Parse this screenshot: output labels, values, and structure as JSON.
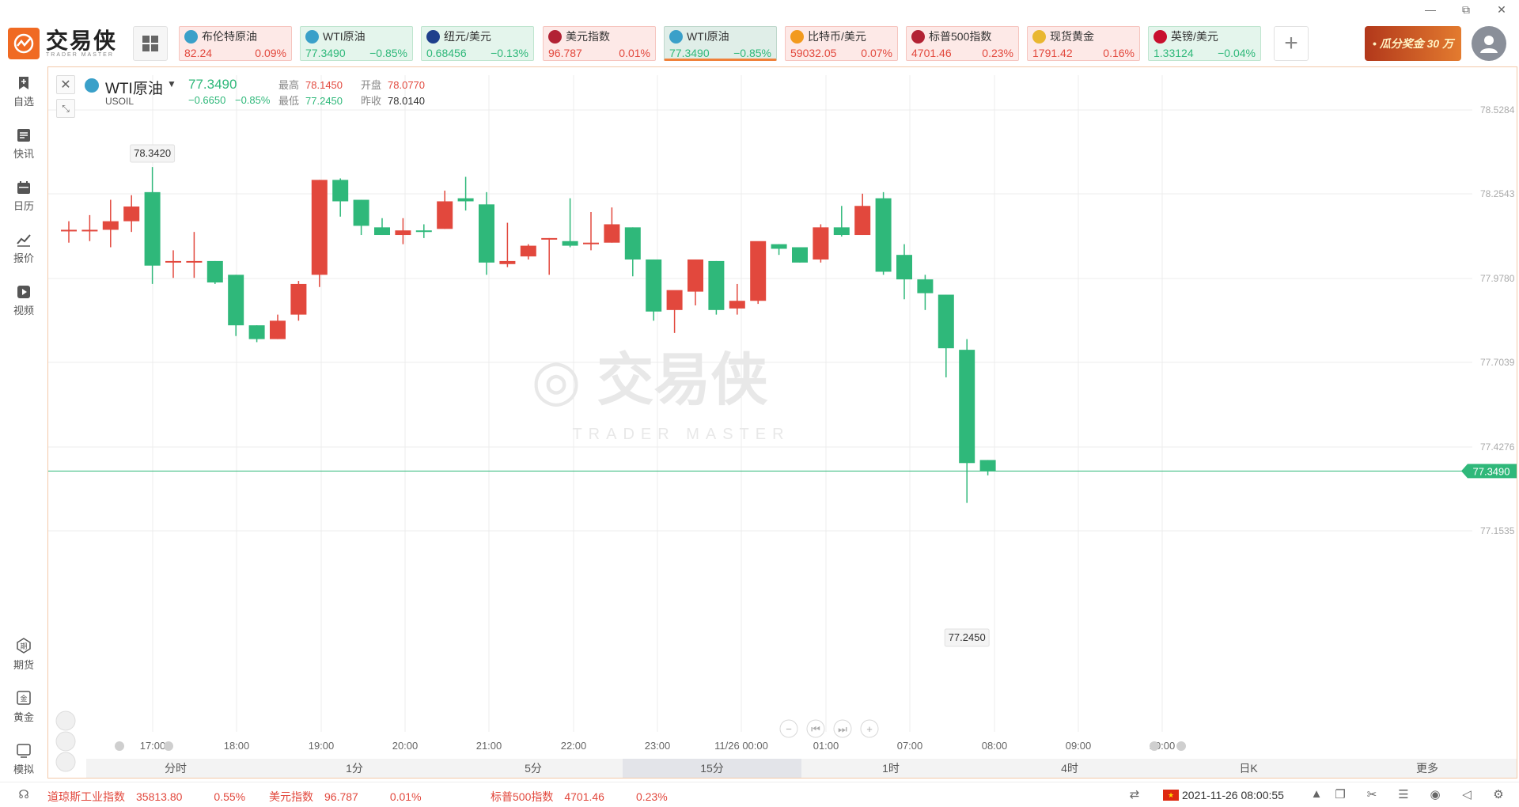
{
  "window": {
    "minimize": "—",
    "restore": "⧉",
    "close": "✕"
  },
  "logo": {
    "cn": "交易侠",
    "en": "TRADER MASTER"
  },
  "tickers": [
    {
      "name": "布伦特原油",
      "price": "82.24",
      "change": "0.09%",
      "dir": "up",
      "flag": "#3aa0c9"
    },
    {
      "name": "WTI原油",
      "price": "77.3490",
      "change": "−0.85%",
      "dir": "dn",
      "flag": "#3aa0c9"
    },
    {
      "name": "纽元/美元",
      "price": "0.68456",
      "change": "−0.13%",
      "dir": "dn",
      "flag": "#1f3f8c"
    },
    {
      "name": "美元指数",
      "price": "96.787",
      "change": "0.01%",
      "dir": "up",
      "flag": "#b22234"
    },
    {
      "name": "WTI原油",
      "price": "77.3490",
      "change": "−0.85%",
      "dir": "sel",
      "flag": "#3aa0c9"
    },
    {
      "name": "比特币/美元",
      "price": "59032.05",
      "change": "0.07%",
      "dir": "up",
      "flag": "#f29a1e"
    },
    {
      "name": "标普500指数",
      "price": "4701.46",
      "change": "0.23%",
      "dir": "up",
      "flag": "#b22234"
    },
    {
      "name": "现货黄金",
      "price": "1791.42",
      "change": "0.16%",
      "dir": "up",
      "flag": "#e9b730"
    },
    {
      "name": "英镑/美元",
      "price": "1.33124",
      "change": "−0.04%",
      "dir": "dn",
      "flag": "#c8102e"
    }
  ],
  "add_label": "+",
  "promo": "• 瓜分奖金 30 万",
  "sidebar": {
    "top": [
      {
        "label": "自选",
        "icon": "bookmark-add-icon"
      },
      {
        "label": "快讯",
        "icon": "news-icon"
      },
      {
        "label": "日历",
        "icon": "calendar-icon"
      },
      {
        "label": "报价",
        "icon": "chart-line-icon"
      },
      {
        "label": "视频",
        "icon": "video-icon"
      }
    ],
    "bottom": [
      {
        "label": "期货",
        "icon": "futures-icon"
      },
      {
        "label": "黄金",
        "icon": "gold-icon"
      },
      {
        "label": "模拟",
        "icon": "simulate-icon"
      }
    ]
  },
  "symbol": {
    "name": "WTI原油",
    "code": "USOIL",
    "price": "77.3490",
    "change": "−0.6650",
    "change_pct": "−0.85%",
    "stats": [
      {
        "key": "最高",
        "value": "78.1450",
        "tone": "up"
      },
      {
        "key": "开盘",
        "value": "78.0770",
        "tone": "up"
      },
      {
        "key": "最低",
        "value": "77.2450",
        "tone": "dn"
      },
      {
        "key": "昨收",
        "value": "78.0140",
        "tone": "n"
      }
    ]
  },
  "chart_data": {
    "type": "candlestick",
    "y_ticks": [
      "78.5284",
      "78.2543",
      "77.9780",
      "77.7039",
      "77.4276",
      "77.1535"
    ],
    "y_tick_values": [
      78.5284,
      78.2543,
      77.978,
      77.7039,
      77.4276,
      77.1535
    ],
    "x_ticks": [
      "17:00",
      "18:00",
      "19:00",
      "20:00",
      "21:00",
      "22:00",
      "23:00",
      "11/26 00:00",
      "01:00",
      "07:00",
      "08:00",
      "09:00",
      "10:00"
    ],
    "current_price": "77.3490",
    "current_price_value": 77.349,
    "high_label": "78.3420",
    "low_label": "77.2450",
    "candles": [
      {
        "o": 78.137,
        "h": 78.165,
        "l": 78.095,
        "c": 78.137
      },
      {
        "o": 78.137,
        "h": 78.185,
        "l": 78.1,
        "c": 78.137
      },
      {
        "o": 78.137,
        "h": 78.235,
        "l": 78.08,
        "c": 78.165
      },
      {
        "o": 78.165,
        "h": 78.25,
        "l": 78.13,
        "c": 78.213
      },
      {
        "o": 78.26,
        "h": 78.342,
        "l": 77.96,
        "c": 78.02
      },
      {
        "o": 78.03,
        "h": 78.07,
        "l": 77.98,
        "c": 78.035
      },
      {
        "o": 78.035,
        "h": 78.13,
        "l": 77.98,
        "c": 78.035
      },
      {
        "o": 78.035,
        "h": 78.035,
        "l": 77.96,
        "c": 77.965
      },
      {
        "o": 77.99,
        "h": 77.99,
        "l": 77.79,
        "c": 77.825
      },
      {
        "o": 77.825,
        "h": 77.825,
        "l": 77.77,
        "c": 77.78
      },
      {
        "o": 77.78,
        "h": 77.86,
        "l": 77.78,
        "c": 77.84
      },
      {
        "o": 77.86,
        "h": 77.97,
        "l": 77.84,
        "c": 77.96
      },
      {
        "o": 77.99,
        "h": 78.3,
        "l": 77.95,
        "c": 78.3
      },
      {
        "o": 78.3,
        "h": 78.305,
        "l": 78.18,
        "c": 78.23
      },
      {
        "o": 78.235,
        "h": 78.235,
        "l": 78.12,
        "c": 78.15
      },
      {
        "o": 78.145,
        "h": 78.175,
        "l": 78.12,
        "c": 78.12
      },
      {
        "o": 78.12,
        "h": 78.175,
        "l": 78.09,
        "c": 78.135
      },
      {
        "o": 78.135,
        "h": 78.155,
        "l": 78.11,
        "c": 78.13
      },
      {
        "o": 78.14,
        "h": 78.265,
        "l": 78.14,
        "c": 78.23
      },
      {
        "o": 78.24,
        "h": 78.31,
        "l": 78.2,
        "c": 78.23
      },
      {
        "o": 78.22,
        "h": 78.26,
        "l": 77.99,
        "c": 78.03
      },
      {
        "o": 78.025,
        "h": 78.16,
        "l": 78.015,
        "c": 78.035
      },
      {
        "o": 78.05,
        "h": 78.09,
        "l": 78.04,
        "c": 78.085
      },
      {
        "o": 78.11,
        "h": 78.11,
        "l": 77.99,
        "c": 78.11
      },
      {
        "o": 78.1,
        "h": 78.24,
        "l": 78.08,
        "c": 78.085
      },
      {
        "o": 78.095,
        "h": 78.195,
        "l": 78.07,
        "c": 78.095
      },
      {
        "o": 78.095,
        "h": 78.21,
        "l": 78.095,
        "c": 78.155
      },
      {
        "o": 78.145,
        "h": 78.145,
        "l": 77.985,
        "c": 78.04
      },
      {
        "o": 78.04,
        "h": 78.04,
        "l": 77.84,
        "c": 77.87
      },
      {
        "o": 77.875,
        "h": 77.925,
        "l": 77.8,
        "c": 77.94
      },
      {
        "o": 77.935,
        "h": 78.04,
        "l": 77.89,
        "c": 78.04
      },
      {
        "o": 78.035,
        "h": 78.035,
        "l": 77.86,
        "c": 77.875
      },
      {
        "o": 77.88,
        "h": 77.96,
        "l": 77.86,
        "c": 77.905
      },
      {
        "o": 77.905,
        "h": 78.075,
        "l": 77.895,
        "c": 78.1
      },
      {
        "o": 78.09,
        "h": 78.09,
        "l": 78.055,
        "c": 78.075
      },
      {
        "o": 78.08,
        "h": 78.08,
        "l": 78.03,
        "c": 78.03
      },
      {
        "o": 78.04,
        "h": 78.155,
        "l": 78.03,
        "c": 78.145
      },
      {
        "o": 78.145,
        "h": 78.215,
        "l": 78.115,
        "c": 78.12
      },
      {
        "o": 78.12,
        "h": 78.255,
        "l": 78.12,
        "c": 78.215
      },
      {
        "o": 78.24,
        "h": 78.26,
        "l": 77.99,
        "c": 78.0
      },
      {
        "o": 78.055,
        "h": 78.09,
        "l": 77.91,
        "c": 77.975
      },
      {
        "o": 77.975,
        "h": 77.99,
        "l": 77.875,
        "c": 77.93
      },
      {
        "o": 77.925,
        "h": 77.925,
        "l": 77.655,
        "c": 77.75
      },
      {
        "o": 77.745,
        "h": 77.78,
        "l": 77.245,
        "c": 77.375
      },
      {
        "o": 77.385,
        "h": 77.385,
        "l": 77.335,
        "c": 77.349
      }
    ]
  },
  "periods": [
    "分时",
    "1分",
    "5分",
    "15分",
    "1时",
    "4时",
    "日K",
    "更多"
  ],
  "active_period": 3,
  "statusbar": [
    {
      "name": "道琼斯工业指数",
      "value": "35813.80",
      "pct": "0.55%"
    },
    {
      "name": "美元指数",
      "value": "96.787",
      "pct": "0.01%"
    },
    {
      "name": "标普500指数",
      "value": "4701.46",
      "pct": "0.23%"
    }
  ],
  "time": "2021-11-26 08:00:55",
  "colors": {
    "up": "#e2483d",
    "down": "#2fb87a",
    "accent": "#f06a23"
  }
}
